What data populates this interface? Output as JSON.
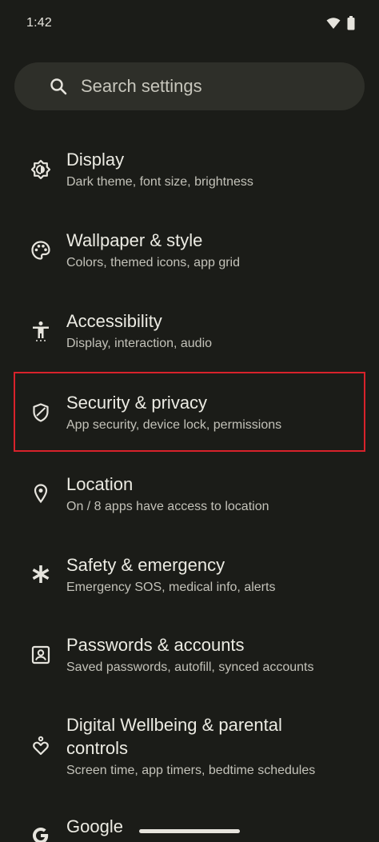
{
  "status_bar": {
    "time": "1:42",
    "icons": [
      "wifi-icon",
      "battery-icon"
    ]
  },
  "search": {
    "placeholder": "Search settings"
  },
  "settings": {
    "items": [
      {
        "title": "Display",
        "subtitle": "Dark theme, font size, brightness",
        "icon": "display-brightness-icon"
      },
      {
        "title": "Wallpaper & style",
        "subtitle": "Colors, themed icons, app grid",
        "icon": "palette-icon"
      },
      {
        "title": "Accessibility",
        "subtitle": "Display, interaction, audio",
        "icon": "accessibility-icon"
      },
      {
        "title": "Security & privacy",
        "subtitle": "App security, device lock, permissions",
        "icon": "shield-icon"
      },
      {
        "title": "Location",
        "subtitle": "On / 8 apps have access to location",
        "icon": "location-pin-icon"
      },
      {
        "title": "Safety & emergency",
        "subtitle": "Emergency SOS, medical info, alerts",
        "icon": "asterisk-icon"
      },
      {
        "title": "Passwords & accounts",
        "subtitle": "Saved passwords, autofill, synced accounts",
        "icon": "account-box-icon"
      },
      {
        "title_line1": "Digital Wellbeing & parental",
        "title_line2": "controls",
        "subtitle": "Screen time, app timers, bedtime schedules",
        "icon": "wellbeing-icon"
      },
      {
        "title": "Google",
        "icon": "google-icon"
      }
    ]
  },
  "colors": {
    "background": "#1b1c18",
    "search_background": "#2e2f29",
    "highlight_border": "#d8222b"
  }
}
